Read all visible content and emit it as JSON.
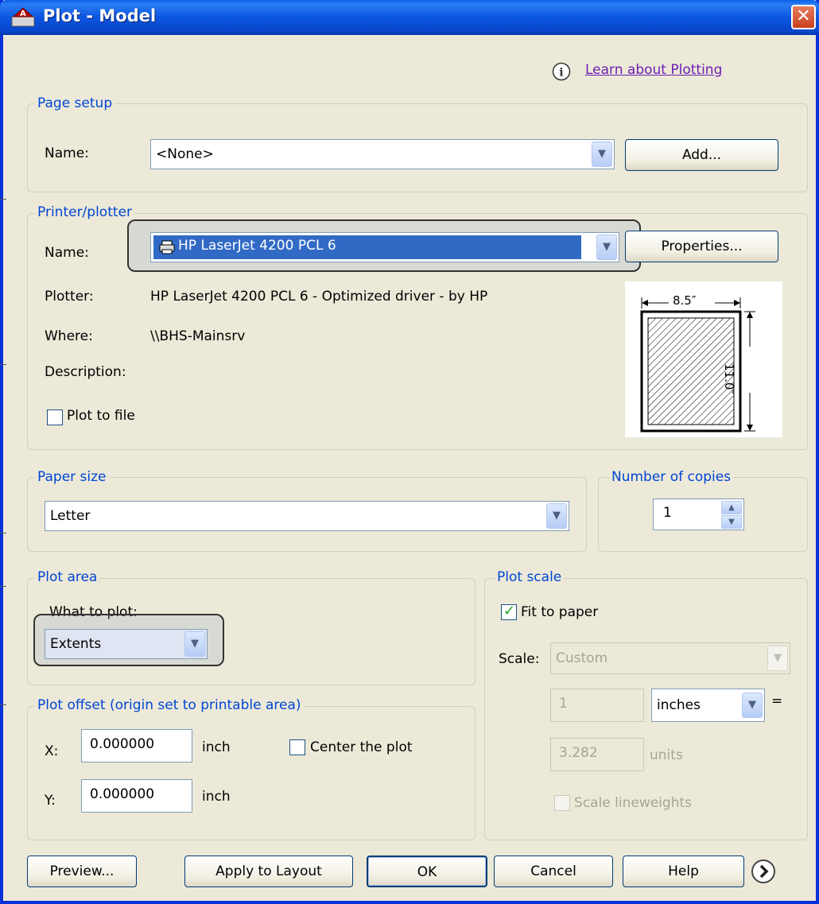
{
  "window": {
    "title": "Plot - Model",
    "close_glyph": "✕"
  },
  "help_link": {
    "icon": "info-icon",
    "text": "Learn about Plotting"
  },
  "page_setup": {
    "legend": "Page setup",
    "name_label": "Name:",
    "name_value": "<None>",
    "add_button": "Add..."
  },
  "printer": {
    "legend": "Printer/plotter",
    "name_label": "Name:",
    "name_value": "HP LaserJet 4200 PCL 6",
    "properties_button": "Properties...",
    "plotter_label": "Plotter:",
    "plotter_value": "HP LaserJet 4200 PCL 6 - Optimized driver - by HP",
    "where_label": "Where:",
    "where_value": "\\\\BHS-Mainsrv",
    "description_label": "Description:",
    "plot_to_file_label": "Plot to file",
    "preview_width": "8.5″",
    "preview_height": "11.0″"
  },
  "paper_size": {
    "legend": "Paper size",
    "value": "Letter"
  },
  "copies": {
    "legend": "Number of copies",
    "value": "1"
  },
  "plot_area": {
    "legend": "Plot area",
    "what_label": "What to plot:",
    "what_value": "Extents"
  },
  "plot_scale": {
    "legend": "Plot scale",
    "fit_label": "Fit to paper",
    "fit_checked": true,
    "scale_label": "Scale:",
    "scale_value": "Custom",
    "value1": "1",
    "unit1": "inches",
    "equals": "=",
    "value2": "3.282",
    "unit2": "units",
    "lineweights_label": "Scale lineweights"
  },
  "plot_offset": {
    "legend": "Plot offset (origin set to printable area)",
    "x_label": "X:",
    "x_value": "0.000000",
    "x_unit": "inch",
    "y_label": "Y:",
    "y_value": "0.000000",
    "y_unit": "inch",
    "center_label": "Center the plot"
  },
  "buttons": {
    "preview": "Preview...",
    "apply": "Apply to Layout",
    "ok": "OK",
    "cancel": "Cancel",
    "help": "Help",
    "more_icon": "chevron-right-circle-icon"
  }
}
